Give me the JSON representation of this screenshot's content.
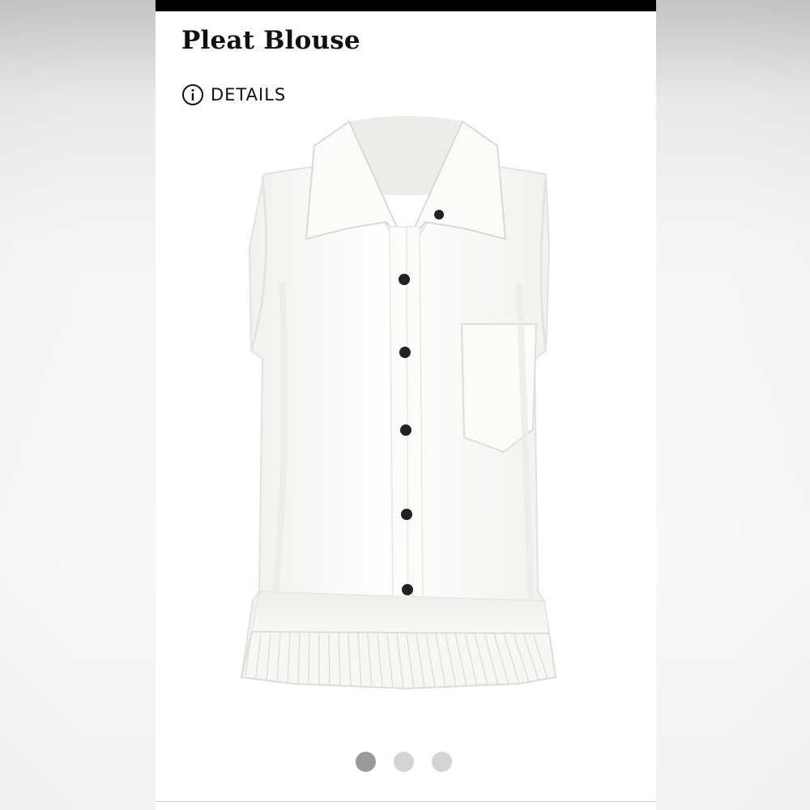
{
  "product": {
    "title": "Pleat Blouse"
  },
  "details": {
    "label": "DETAILS",
    "icon": "info-circle-icon"
  },
  "image": {
    "subject": "white sleeveless blouse",
    "colors": {
      "fabric": "#f7f7f5",
      "shadow": "#e3e3e1",
      "buttons": "#222222"
    }
  },
  "carousel": {
    "total": 3,
    "active_index": 0,
    "colors": {
      "active": "#9a9a9a",
      "inactive": "#d4d4d4"
    }
  }
}
